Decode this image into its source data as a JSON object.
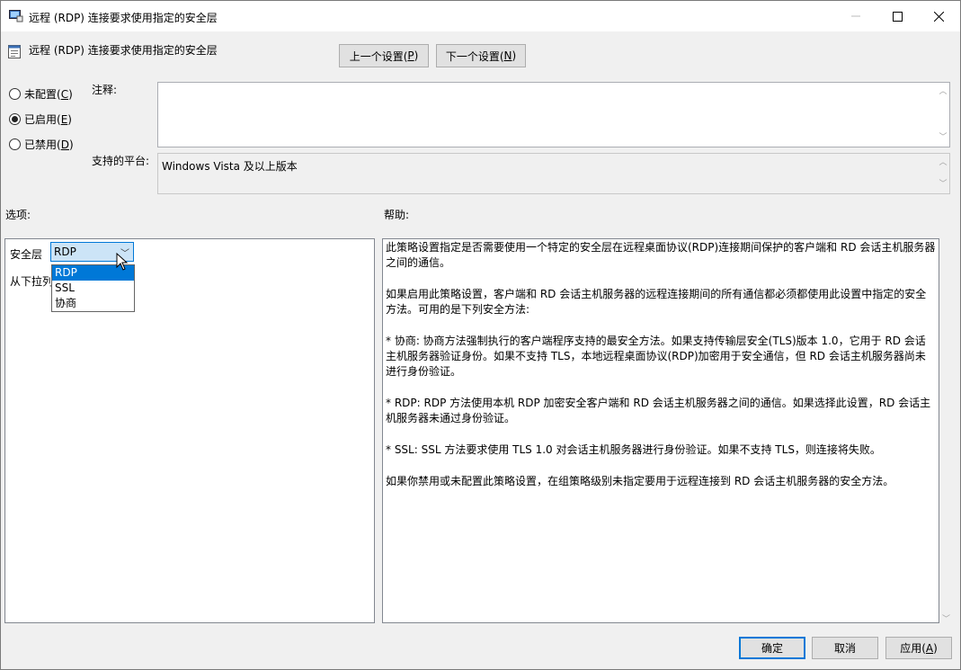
{
  "window": {
    "title": "远程 (RDP) 连接要求使用指定的安全层",
    "minimize_icon": "minimize-icon",
    "maximize_icon": "maximize-icon",
    "close_icon": "close-icon"
  },
  "header": {
    "title": "远程 (RDP) 连接要求使用指定的安全层",
    "prev_button": "上一个设置(P)",
    "prev_text": "上一个设置(",
    "prev_key": "P",
    "next_text": "下一个设置(",
    "next_key": "N"
  },
  "state": {
    "options": [
      {
        "text": "未配置(",
        "key": "C",
        "checked": false
      },
      {
        "text": "已启用(",
        "key": "E",
        "checked": true
      },
      {
        "text": "已禁用(",
        "key": "D",
        "checked": false
      }
    ]
  },
  "comment": {
    "label": "注释:",
    "value": ""
  },
  "platform": {
    "label": "支持的平台:",
    "value": "Windows Vista 及以上版本"
  },
  "options_panel": {
    "heading": "选项:",
    "security_label": "安全层",
    "dropdown_hint": "从下拉列",
    "selected": "RDP",
    "choices": [
      "RDP",
      "SSL",
      "协商"
    ]
  },
  "help_panel": {
    "heading": "帮助:",
    "paragraphs": [
      "此策略设置指定是否需要使用一个特定的安全层在远程桌面协议(RDP)连接期间保护的客户端和 RD 会话主机服务器之间的通信。",
      "如果启用此策略设置，客户端和 RD 会话主机服务器的远程连接期间的所有通信都必须都使用此设置中指定的安全方法。可用的是下列安全方法:",
      " * 协商: 协商方法强制执行的客户端程序支持的最安全方法。如果支持传输层安全(TLS)版本 1.0，它用于 RD 会话主机服务器验证身份。如果不支持 TLS，本地远程桌面协议(RDP)加密用于安全通信，但 RD 会话主机服务器尚未进行身份验证。",
      " * RDP: RDP 方法使用本机 RDP 加密安全客户端和 RD 会话主机服务器之间的通信。如果选择此设置，RD 会话主机服务器未通过身份验证。",
      " * SSL: SSL 方法要求使用 TLS 1.0 对会话主机服务器进行身份验证。如果不支持 TLS，则连接将失败。",
      "如果你禁用或未配置此策略设置，在组策略级别未指定要用于远程连接到 RD 会话主机服务器的安全方法。"
    ]
  },
  "footer": {
    "ok": "确定",
    "cancel": "取消",
    "apply_text": "应用(",
    "apply_key": "A"
  },
  "colors": {
    "accent": "#0078d7",
    "selection_bg": "#cce4f7"
  }
}
